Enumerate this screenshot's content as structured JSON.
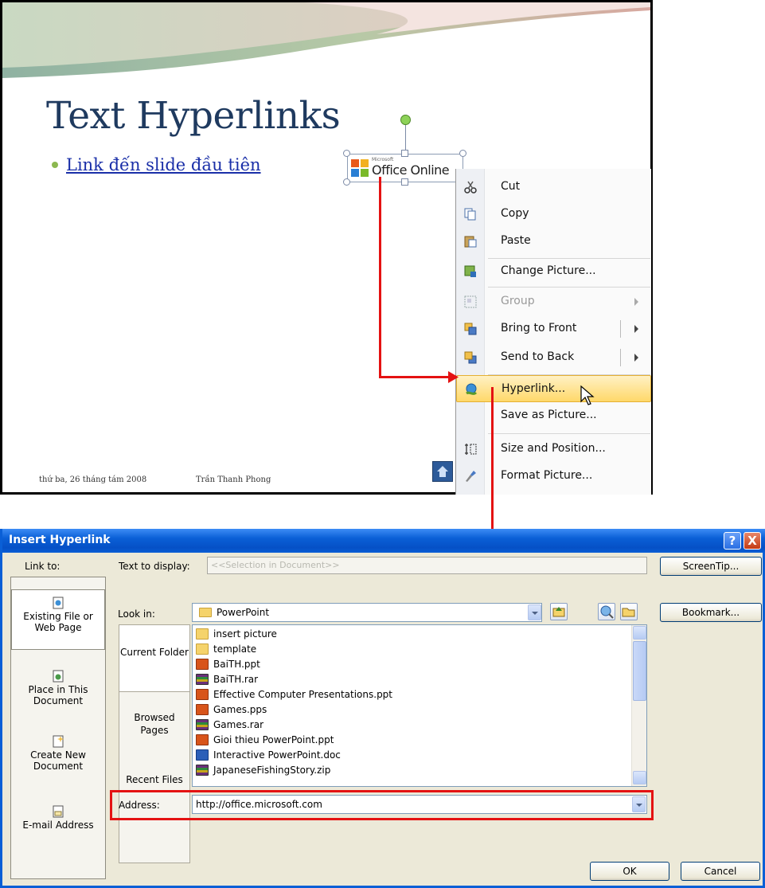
{
  "slide": {
    "title": "Text Hyperlinks",
    "bullet_link": "Link đến slide đầu tiên",
    "footer_date": "thứ ba, 26 tháng tám 2008",
    "footer_author": "Trần Thanh Phong",
    "picture": {
      "small_text": "Microsoft",
      "main_text": "Office Online"
    }
  },
  "context_menu": {
    "items": [
      {
        "label": "Cut",
        "icon": "scissors-icon"
      },
      {
        "label": "Copy",
        "icon": "copy-icon"
      },
      {
        "label": "Paste",
        "icon": "paste-icon"
      },
      {
        "label": "Change Picture...",
        "icon": "change-picture-icon"
      },
      {
        "label": "Group",
        "icon": "group-icon",
        "disabled": true
      },
      {
        "label": "Bring to Front",
        "icon": "bring-to-front-icon"
      },
      {
        "label": "Send to Back",
        "icon": "send-to-back-icon"
      },
      {
        "label": "Hyperlink...",
        "icon": "hyperlink-icon",
        "highlighted": true
      },
      {
        "label": "Save as Picture...",
        "icon": ""
      },
      {
        "label": "Size and Position...",
        "icon": "size-position-icon"
      },
      {
        "label": "Format Picture...",
        "icon": "format-picture-icon"
      }
    ]
  },
  "dialog": {
    "title": "Insert Hyperlink",
    "help": "?",
    "close": "X",
    "link_to_label": "Link to:",
    "text_to_display_label": "Text to display:",
    "text_to_display_value": "<<Selection in Document>>",
    "screentip_button": "ScreenTip...",
    "nav": [
      {
        "label": "Existing File or Web Page",
        "icon": "web-page-icon",
        "selected": true
      },
      {
        "label": "Place in This Document",
        "icon": "document-place-icon"
      },
      {
        "label": "Create New Document",
        "icon": "new-document-icon"
      },
      {
        "label": "E-mail Address",
        "icon": "email-icon"
      }
    ],
    "look_in_label": "Look in:",
    "look_in_value": "PowerPoint",
    "subnav": [
      {
        "label": "Current Folder",
        "selected": true
      },
      {
        "label": "Browsed Pages"
      },
      {
        "label": "Recent Files"
      }
    ],
    "files": [
      {
        "name": "insert picture",
        "type": "folder"
      },
      {
        "name": "template",
        "type": "folder"
      },
      {
        "name": "BaiTH.ppt",
        "type": "ppt"
      },
      {
        "name": "BaiTH.rar",
        "type": "rar"
      },
      {
        "name": "Effective Computer Presentations.ppt",
        "type": "ppt"
      },
      {
        "name": "Games.pps",
        "type": "ppt"
      },
      {
        "name": "Games.rar",
        "type": "rar"
      },
      {
        "name": "Gioi thieu PowerPoint.ppt",
        "type": "ppt"
      },
      {
        "name": "Interactive PowerPoint.doc",
        "type": "doc"
      },
      {
        "name": "JapaneseFishingStory.zip",
        "type": "rar"
      }
    ],
    "bookmark_button": "Bookmark...",
    "address_label": "Address:",
    "address_value": "http://office.microsoft.com",
    "ok_button": "OK",
    "cancel_button": "Cancel"
  },
  "colors": {
    "accent_red": "#e41212",
    "titlebar_blue": "#0a5fd6",
    "dialog_bg": "#ece9d8"
  }
}
